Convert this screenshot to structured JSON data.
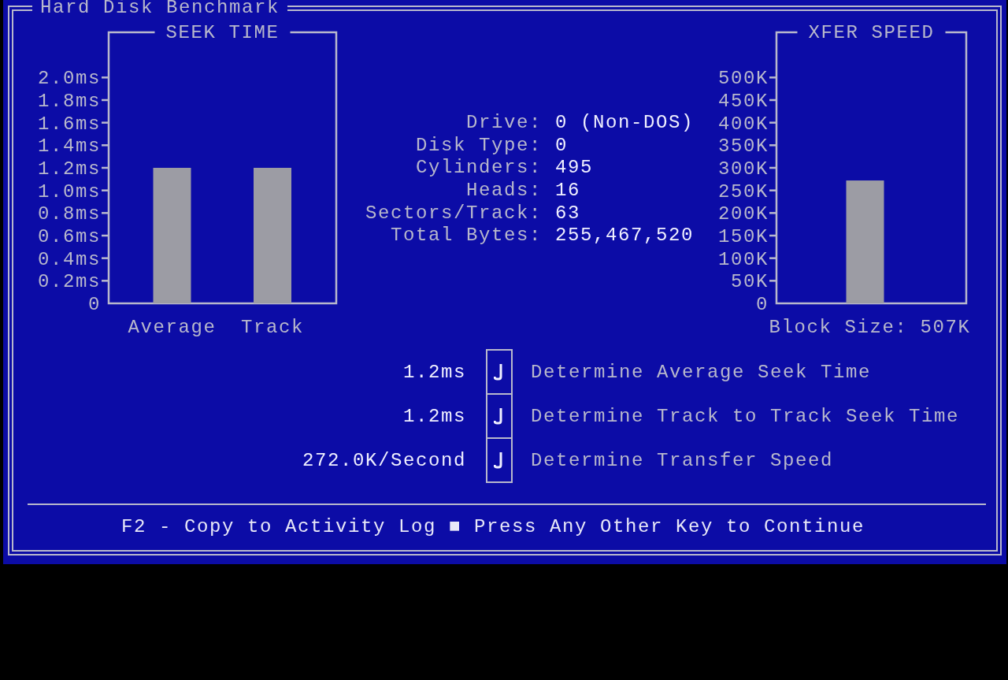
{
  "window": {
    "title": "Hard Disk Benchmark"
  },
  "seek_chart": {
    "chart_data": {
      "type": "bar",
      "title": "SEEK TIME",
      "categories": [
        "Average",
        "Track"
      ],
      "values": [
        1.2,
        1.2
      ],
      "ylim": [
        0,
        2.4
      ],
      "yticks": [
        {
          "value": 0,
          "label": "0"
        },
        {
          "value": 0.2,
          "label": "0.2ms"
        },
        {
          "value": 0.4,
          "label": "0.4ms"
        },
        {
          "value": 0.6,
          "label": "0.6ms"
        },
        {
          "value": 0.8,
          "label": "0.8ms"
        },
        {
          "value": 1.0,
          "label": "1.0ms"
        },
        {
          "value": 1.2,
          "label": "1.2ms"
        },
        {
          "value": 1.4,
          "label": "1.4ms"
        },
        {
          "value": 1.6,
          "label": "1.6ms"
        },
        {
          "value": 1.8,
          "label": "1.8ms"
        },
        {
          "value": 2.0,
          "label": "2.0ms"
        }
      ]
    }
  },
  "drive_info": [
    {
      "label": "Drive:",
      "value": "0 (Non-DOS)"
    },
    {
      "label": "Disk Type:",
      "value": "0"
    },
    {
      "label": "Cylinders:",
      "value": "495"
    },
    {
      "label": "Heads:",
      "value": "16"
    },
    {
      "label": "Sectors/Track:",
      "value": "63"
    },
    {
      "label": "Total Bytes:",
      "value": "255,467,520"
    }
  ],
  "xfer_chart": {
    "chart_data": {
      "type": "bar",
      "title": "XFER SPEED",
      "xlabel": "Block Size: 507K",
      "values": [
        272
      ],
      "ylim": [
        0,
        600
      ],
      "yticks": [
        {
          "value": 0,
          "label": "0"
        },
        {
          "value": 50,
          "label": "50K"
        },
        {
          "value": 100,
          "label": "100K"
        },
        {
          "value": 150,
          "label": "150K"
        },
        {
          "value": 200,
          "label": "200K"
        },
        {
          "value": 250,
          "label": "250K"
        },
        {
          "value": 300,
          "label": "300K"
        },
        {
          "value": 350,
          "label": "350K"
        },
        {
          "value": 400,
          "label": "400K"
        },
        {
          "value": 450,
          "label": "450K"
        },
        {
          "value": 500,
          "label": "500K"
        }
      ]
    }
  },
  "tests": [
    {
      "result": "1.2ms",
      "checked": true,
      "label": "Determine Average Seek Time"
    },
    {
      "result": "1.2ms",
      "checked": true,
      "label": "Determine Track to Track Seek Time"
    },
    {
      "result": "272.0K/Second",
      "checked": true,
      "label": "Determine Transfer Speed"
    }
  ],
  "status_bar": {
    "text": "F2 - Copy to Activity Log ■ Press Any Other Key to Continue"
  }
}
